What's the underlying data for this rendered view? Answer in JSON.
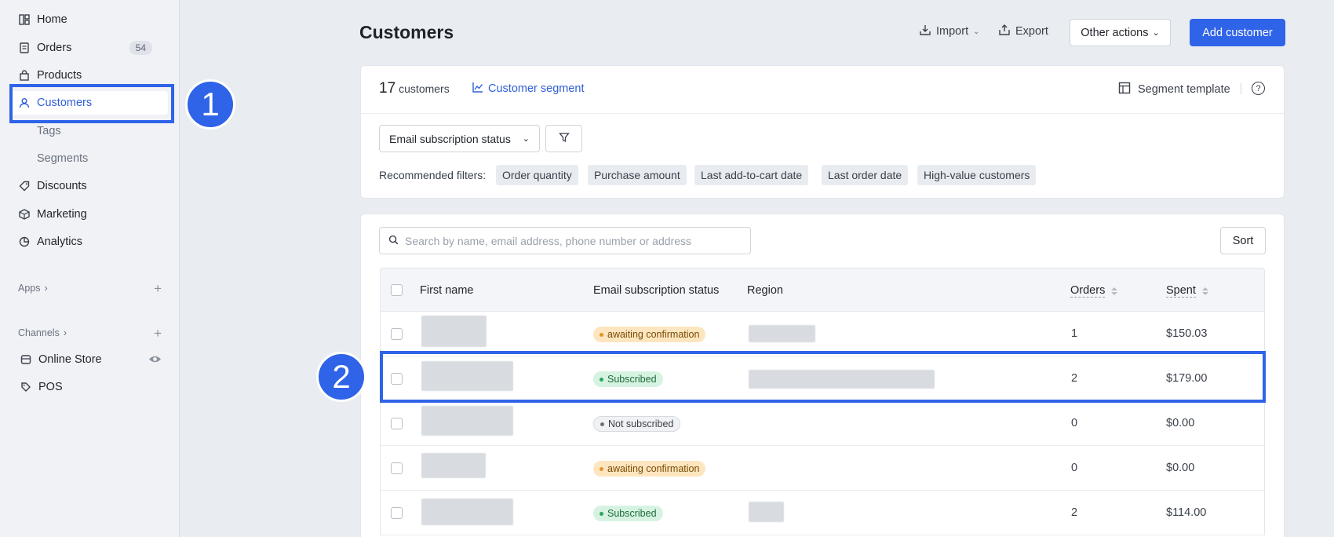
{
  "sidebar": {
    "items": [
      {
        "label": "Home",
        "icon": "home-icon"
      },
      {
        "label": "Orders",
        "icon": "orders-icon",
        "badge": "54"
      },
      {
        "label": "Products",
        "icon": "bag-icon"
      },
      {
        "label": "Customers",
        "icon": "user-icon"
      },
      {
        "label": "Tags"
      },
      {
        "label": "Segments"
      },
      {
        "label": "Discounts",
        "icon": "tag-icon"
      },
      {
        "label": "Marketing",
        "icon": "box-icon"
      },
      {
        "label": "Analytics",
        "icon": "pie-chart-icon"
      }
    ],
    "apps_label": "Apps",
    "channels_label": "Channels",
    "channels": [
      {
        "label": "Online Store",
        "icon": "store-icon"
      },
      {
        "label": "POS",
        "icon": "pos-icon"
      }
    ]
  },
  "callouts": {
    "one": "1",
    "two": "2"
  },
  "header": {
    "title": "Customers",
    "import_label": "Import",
    "export_label": "Export",
    "other_actions_label": "Other actions",
    "add_customer_label": "Add customer"
  },
  "summary": {
    "count": "17",
    "count_suffix": "customers",
    "segment_link": "Customer segment",
    "segment_template": "Segment template"
  },
  "filters": {
    "dropdown_label": "Email subscription status",
    "recommended_label": "Recommended filters:",
    "chips": [
      "Order quantity",
      "Purchase amount",
      "Last add-to-cart date",
      "Last order date",
      "High-value customers"
    ]
  },
  "table": {
    "search_placeholder": "Search by name, email address, phone number or address",
    "sort_label": "Sort",
    "columns": {
      "first_name": "First name",
      "email_status": "Email subscription status",
      "region": "Region",
      "orders": "Orders",
      "spent": "Spent"
    },
    "rows": [
      {
        "status": "awaiting confirmation",
        "status_type": "warning",
        "orders": "1",
        "spent": "$150.03"
      },
      {
        "status": "Subscribed",
        "status_type": "success",
        "orders": "2",
        "spent": "$179.00"
      },
      {
        "status": "Not subscribed",
        "status_type": "neutral",
        "orders": "0",
        "spent": "$0.00"
      },
      {
        "status": "awaiting confirmation",
        "status_type": "warning",
        "orders": "0",
        "spent": "$0.00"
      },
      {
        "status": "Subscribed",
        "status_type": "success",
        "orders": "2",
        "spent": "$114.00"
      }
    ]
  },
  "colors": {
    "accent": "#2f63e8",
    "warning_bg": "#fde6bf",
    "success_bg": "#d6f3e1",
    "neutral_bg": "#f1f2f4"
  }
}
